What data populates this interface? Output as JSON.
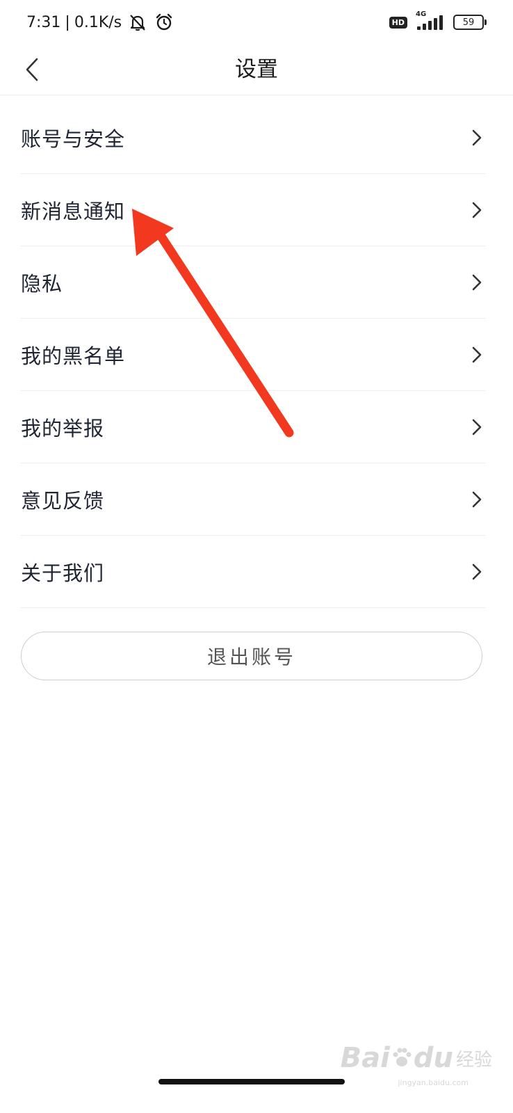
{
  "status_bar": {
    "time": "7:31",
    "separator": "|",
    "net_speed": "0.1K/s",
    "hd_label": "HD",
    "network_type": "4G",
    "battery_level": "59",
    "icons": [
      "bell-muted-icon",
      "alarm-icon",
      "signal-icon",
      "battery-icon"
    ]
  },
  "nav": {
    "title": "设置",
    "back_icon": "chevron-left-icon"
  },
  "menu": {
    "items": [
      {
        "label": "账号与安全"
      },
      {
        "label": "新消息通知"
      },
      {
        "label": "隐私"
      },
      {
        "label": "我的黑名单"
      },
      {
        "label": "我的举报"
      },
      {
        "label": "意见反馈"
      },
      {
        "label": "关于我们"
      }
    ],
    "chevron_icon": "chevron-right-icon"
  },
  "logout": {
    "label": "退出账号"
  },
  "annotation": {
    "color": "#f2391f",
    "icon": "red-arrow-annotation"
  },
  "watermark": {
    "brand": "Bai",
    "brand_suffix": "du",
    "cn": "经验",
    "url": "jingyan.baidu.com"
  },
  "colors": {
    "text": "#1f2533",
    "divider": "#ececec",
    "background": "#ffffff"
  }
}
